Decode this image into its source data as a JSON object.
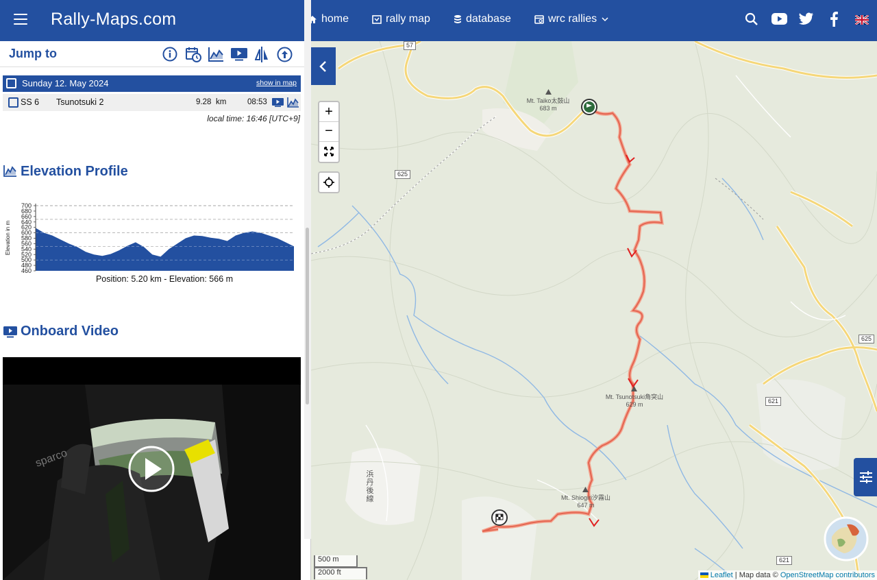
{
  "header": {
    "brand": "Rally-Maps.com",
    "nav": [
      {
        "label": "home",
        "icon": "home-icon"
      },
      {
        "label": "rally map",
        "icon": "map-icon"
      },
      {
        "label": "database",
        "icon": "database-icon"
      },
      {
        "label": "wrc rallies",
        "icon": "calendar-icon"
      }
    ],
    "right_icons": [
      "search-icon",
      "youtube-icon",
      "twitter-icon",
      "facebook-icon",
      "uk-flag-icon"
    ]
  },
  "panel": {
    "jump_to": "Jump to",
    "jump_icons": [
      "info-icon",
      "schedule-icon",
      "elevation-icon",
      "video-icon",
      "compare-icon",
      "up-icon"
    ],
    "day_row": {
      "label": "Sunday 12. May 2024",
      "show_in_map": "show in map"
    },
    "stage": {
      "number": "SS 6",
      "name": "Tsunotsuki 2",
      "distance": "9.28",
      "unit": "km",
      "time": "08:53"
    },
    "local_time": "local time: 16:46 [UTC+9]",
    "elevation_title": "Elevation Profile",
    "onboard_title": "Onboard Video"
  },
  "chart_data": {
    "type": "area",
    "title": "",
    "xlabel": "",
    "ylabel": "Elevation in m",
    "ylim": [
      460,
      700
    ],
    "yticks": [
      460,
      480,
      500,
      520,
      540,
      560,
      580,
      600,
      620,
      640,
      660,
      680,
      700
    ],
    "x": [
      0,
      0.3,
      0.6,
      1.0,
      1.4,
      1.8,
      2.2,
      2.6,
      3.0,
      3.4,
      3.8,
      4.2,
      4.6,
      5.0,
      5.2,
      5.6,
      6.0,
      6.4,
      6.8,
      7.2,
      7.6,
      8.0,
      8.4,
      8.8,
      9.28
    ],
    "series": [
      {
        "values": [
          618,
          600,
          590,
          575,
          560,
          548,
          530,
          520,
          515,
          522,
          535,
          552,
          565,
          548,
          520,
          512,
          540,
          560,
          580,
          590,
          588,
          582,
          578,
          570,
          590,
          600,
          605,
          600,
          590,
          580,
          565,
          550
        ]
      }
    ],
    "caption": "Position: 5.20 km - Elevation: 566 m"
  },
  "map": {
    "zoom_in": "+",
    "zoom_out": "−",
    "scale_metric": "500 m",
    "scale_imperial": "2000 ft",
    "attribution_leaflet": "Leaflet",
    "attribution_text": "| Map data ©",
    "attribution_osm": "OpenStreetMap contributors",
    "peaks": [
      {
        "name": "Mt. Taiko太鼓山",
        "elev": "683 m"
      },
      {
        "name": "Mt. Tsunotsuki角突山",
        "elev": "629 m"
      },
      {
        "name": "Mt. Shiogiri汐霧山",
        "elev": "647 m"
      }
    ],
    "road_shields": [
      "57",
      "625",
      "625",
      "621",
      "621"
    ],
    "road_name": "浜丹後線"
  }
}
